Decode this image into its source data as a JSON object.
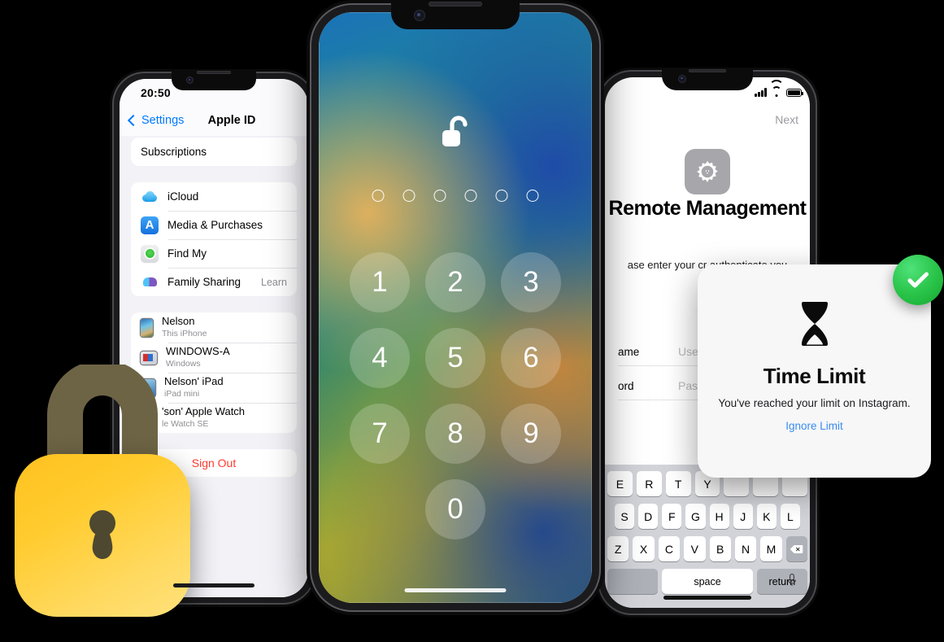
{
  "left_phone": {
    "status": {
      "time": "20:50"
    },
    "nav": {
      "back_label": "Settings",
      "title": "Apple ID"
    },
    "subscriptions_label": "Subscriptions",
    "services": [
      {
        "label": "iCloud",
        "icon": "icloud-icon",
        "trailing": ""
      },
      {
        "label": "Media & Purchases",
        "icon": "app-store-icon",
        "trailing": ""
      },
      {
        "label": "Find My",
        "icon": "find-my-icon",
        "trailing": ""
      },
      {
        "label": "Family Sharing",
        "icon": "family-sharing-icon",
        "trailing": "Learn"
      }
    ],
    "devices": [
      {
        "name": "Nelson",
        "sub": "This iPhone",
        "icon": "iphone-icon"
      },
      {
        "name": "WINDOWS-A",
        "sub": "Windows",
        "icon": "windows-pc-icon"
      },
      {
        "name": "Nelson' iPad",
        "sub": "iPad mini",
        "icon": "ipad-icon"
      },
      {
        "name": "'son' Apple Watch",
        "sub": "le Watch SE",
        "icon": "apple-watch-icon"
      }
    ],
    "sign_out_label": "Sign Out",
    "sign_out_color": "#ff3b30"
  },
  "center_phone": {
    "lock_icon": "unlocked-padlock-icon",
    "passcode_dots": 6,
    "keypad": [
      "1",
      "2",
      "3",
      "4",
      "5",
      "6",
      "7",
      "8",
      "9",
      "0"
    ]
  },
  "right_phone": {
    "status": {
      "signal": "signal-bars-icon",
      "wifi": "wifi-icon",
      "battery": "battery-icon"
    },
    "next_label": "Next",
    "app_icon": "gear-icon",
    "title": "Remote Management",
    "description": "ase enter your cr authenticate you",
    "fields": [
      {
        "label": "ame",
        "placeholder": "Username"
      },
      {
        "label": "ord",
        "placeholder": "Password"
      }
    ],
    "keyboard": {
      "row1": [
        "E",
        "R",
        "T",
        "Y"
      ],
      "row2": [
        "S",
        "D",
        "F",
        "G",
        "H",
        "J",
        "K",
        "L"
      ],
      "row3": [
        "Z",
        "X",
        "C",
        "V",
        "B",
        "N",
        "M"
      ],
      "backspace_label": "delete-icon",
      "space_label": "space",
      "return_label": "return",
      "mic_label": "microphone-icon"
    }
  },
  "time_limit_dialog": {
    "icon": "hourglass-icon",
    "title": "Time Limit",
    "message": "You've reached your limit on Instagram.",
    "link_label": "Ignore Limit",
    "link_color": "#3a8cf0"
  },
  "badges": {
    "check_icon": "green-check-badge",
    "check_color": "#2ec84f"
  },
  "padlock": {
    "icon": "yellow-padlock-icon",
    "body_color": "#ffcb2e",
    "shackle_color": "#6d6445"
  }
}
